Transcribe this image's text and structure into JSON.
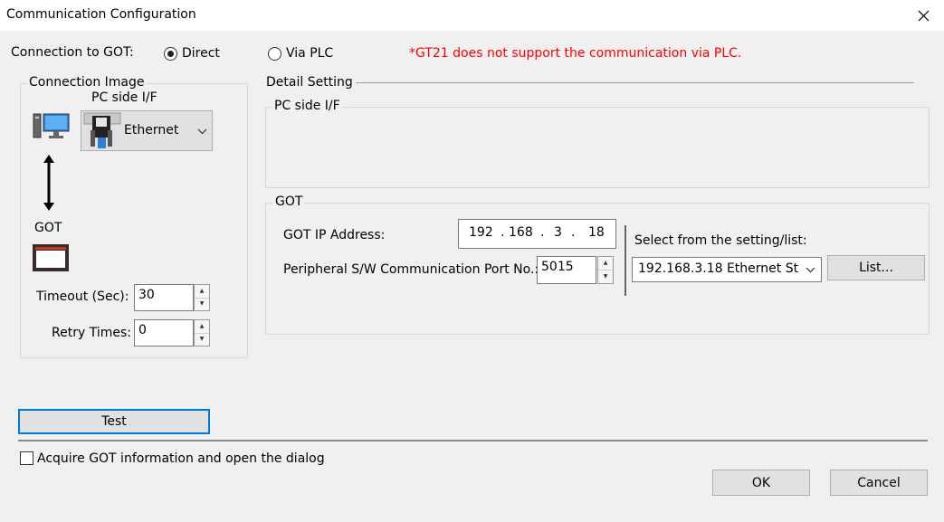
{
  "window": {
    "title": "Communication Configuration",
    "close_glyph": "✕"
  },
  "connection": {
    "label": "Connection to GOT:",
    "direct_label": "Direct",
    "via_plc_label": "Via PLC",
    "selected": "Direct",
    "warning": "*GT21 does not support the communication via PLC.",
    "warning_color": "#ff0000"
  },
  "image_group": {
    "title": "Connection Image",
    "pc_side_label": "PC side I/F",
    "interface_value": "Ethernet",
    "got_label": "GOT",
    "icons": [
      "pc-icon",
      "usb-ethernet-icon",
      "double-arrow-icon",
      "got-device-icon"
    ]
  },
  "timeout": {
    "label": "Timeout (Sec):",
    "value": "30"
  },
  "retry": {
    "label": "Retry Times:",
    "value": "0"
  },
  "detail": {
    "title": "Detail Setting",
    "pc_side_title": "PC side I/F",
    "got_title": "GOT",
    "ip_label": "GOT IP Address:",
    "ip_parts": [
      "192",
      "168",
      "3",
      "18"
    ],
    "ip_sep": ".",
    "port_label": "Peripheral S/W Communication Port No.:",
    "port_value": "5015",
    "select_label": "Select from the setting/list:",
    "select_value": "192.168.3.18 Ethernet St",
    "list_button": "List..."
  },
  "buttons": {
    "test": "Test",
    "ok": "OK",
    "cancel": "Cancel"
  },
  "acquire": {
    "label": "Acquire GOT information and open the dialog",
    "checked": false
  }
}
